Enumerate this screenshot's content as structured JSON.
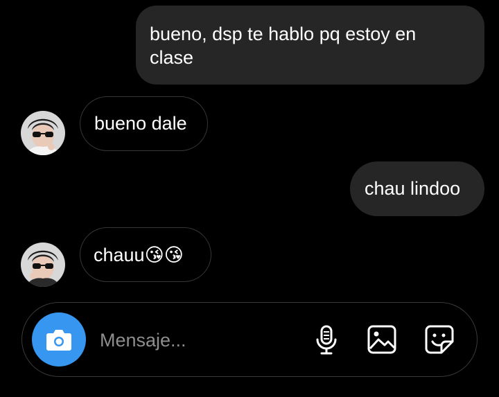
{
  "messages": [
    {
      "side": "sent",
      "lines": [
        "bueno, dsp te hablo pq estoy en",
        "clase"
      ]
    },
    {
      "side": "received",
      "text": "bueno dale",
      "avatar_icon": "user-avatar"
    },
    {
      "side": "sent",
      "text": "chau lindoo"
    },
    {
      "side": "received",
      "text": "chauu😘😘",
      "avatar_icon": "user-avatar"
    }
  ],
  "composer": {
    "placeholder": "Mensaje...",
    "camera_icon": "camera-icon",
    "mic_icon": "microphone-icon",
    "gallery_icon": "image-icon",
    "sticker_icon": "sticker-icon"
  },
  "colors": {
    "background": "#000000",
    "sent_bubble": "#262626",
    "received_border": "#363636",
    "accent": "#3797f0",
    "placeholder": "#8e8e8e"
  }
}
